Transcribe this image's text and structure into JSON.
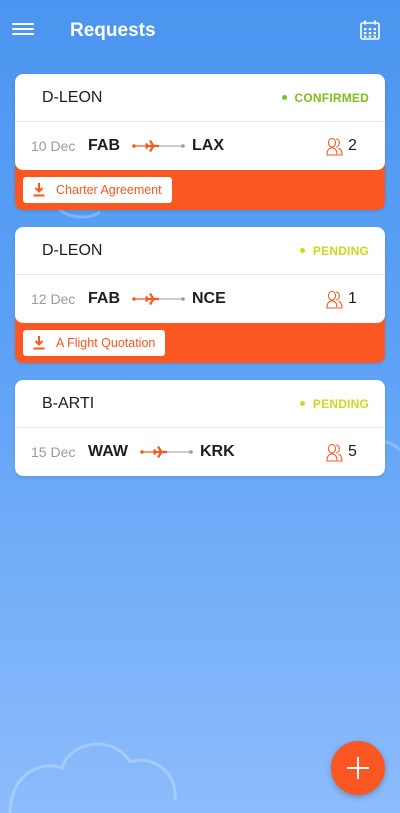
{
  "header": {
    "title": "Requests",
    "menu_icon": "hamburger-menu-icon",
    "calendar_icon": "calendar-icon"
  },
  "colors": {
    "accent": "#fb5722",
    "confirmed": "#7ec01e",
    "pending": "#cfd820",
    "background_top": "#4b95f0"
  },
  "requests": [
    {
      "tail": "D-LEON",
      "status": "CONFIRMED",
      "date": "10 Dec",
      "from": "FAB",
      "to": "LAX",
      "passengers": "2",
      "document": "Charter Agreement"
    },
    {
      "tail": "D-LEON",
      "status": "PENDING",
      "date": "12 Dec",
      "from": "FAB",
      "to": "NCE",
      "passengers": "1",
      "document": "A Flight Quotation"
    },
    {
      "tail": "B-ARTI",
      "status": "PENDING",
      "date": "15 Dec",
      "from": "WAW",
      "to": "KRK",
      "passengers": "5"
    }
  ],
  "fab": {
    "icon": "plus-icon"
  }
}
